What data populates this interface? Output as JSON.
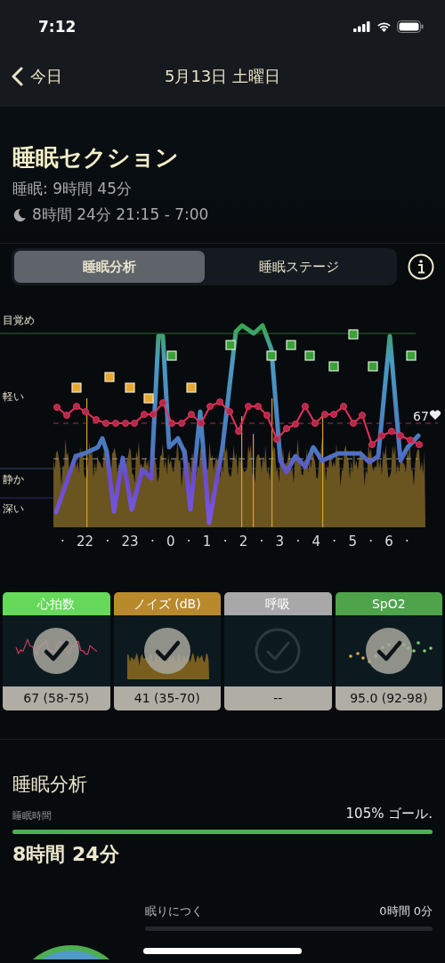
{
  "status_bar": {
    "time": "7:12"
  },
  "nav": {
    "back_label": "今日",
    "title": "5月13日 土曜日"
  },
  "section": {
    "title": "睡眠セクション",
    "sleep_total": "睡眠: 9時間 45分",
    "sleep_detail": "8時間 24分 21:15 - 7:00"
  },
  "tabs": [
    {
      "label": "睡眠分析",
      "selected": true
    },
    {
      "label": "睡眠ステージ",
      "selected": false
    }
  ],
  "chart": {
    "y_labels": [
      "目覚め",
      "軽い",
      "静か",
      "深い"
    ],
    "heart_rate": "67",
    "x_ticks": [
      "·",
      "22",
      "·",
      "23",
      "·",
      "0",
      "·",
      "1",
      "·",
      "2",
      "·",
      "3",
      "·",
      "4",
      "·",
      "5",
      "·",
      "6",
      "·"
    ]
  },
  "cards": [
    {
      "kind": "heart",
      "title": "心拍数",
      "color": "#66d95a",
      "checked": true,
      "value": "67 (58-75)"
    },
    {
      "kind": "noise",
      "title": "ノイズ (dB)",
      "color": "#b98a2c",
      "checked": true,
      "value": "41 (35-70)"
    },
    {
      "kind": "breath",
      "title": "呼吸",
      "color": "#a8a8a8",
      "checked": false,
      "value": "--"
    },
    {
      "kind": "spo2",
      "title": "SpO2",
      "color": "#4fa44b",
      "checked": true,
      "value": "95.0 (92-98)"
    }
  ],
  "analysis": {
    "title": "睡眠分析",
    "label": "睡眠時間",
    "goal": "105% ゴール.",
    "level": 1,
    "duration": "8時間 24分",
    "stages": [
      {
        "label": "眠りにつく",
        "value": "0時間 0分"
      }
    ]
  }
}
